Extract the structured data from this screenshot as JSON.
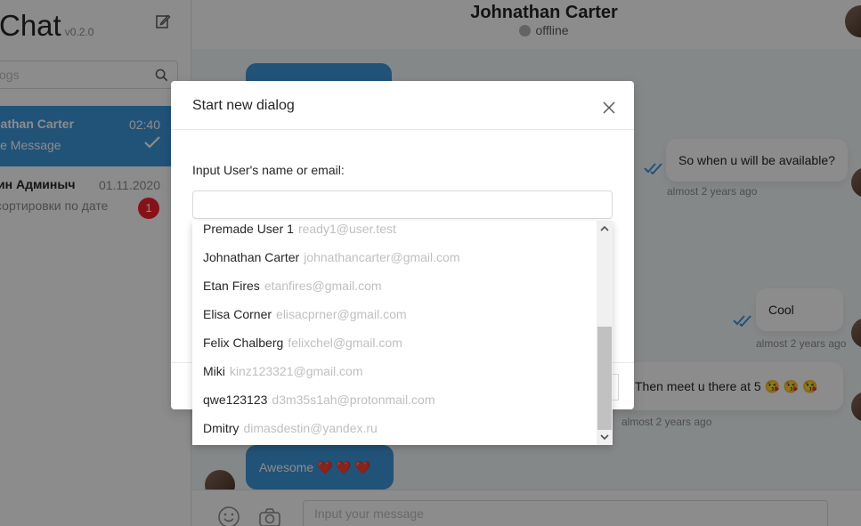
{
  "app": {
    "logo_text": "-Chat",
    "version": "v0.2.0"
  },
  "sidebar": {
    "search_placeholder": "ogs",
    "dialogs": [
      {
        "name": "nathan Carter",
        "time": "02:40",
        "preview": "ice Message",
        "status": "read"
      },
      {
        "name": "ин Админыч",
        "time": "01.11.2020",
        "preview": "сортировки по дате",
        "unread": "1"
      }
    ]
  },
  "chat": {
    "partner_name": "Johnathan Carter",
    "partner_status": "offline",
    "messages": [
      {
        "text": "So when u will be available?",
        "time": "almost 2 years ago",
        "direction": "in"
      },
      {
        "text": "Cool",
        "time": "almost 2 years ago",
        "direction": "in"
      },
      {
        "text": "Then meet u there at 5",
        "emoji": "😘 😘 😘",
        "time": "almost 2 years ago",
        "direction": "in"
      },
      {
        "text": "Awesome",
        "emoji": "❤️ ❤️ ❤️",
        "direction": "out"
      }
    ],
    "input_placeholder": "Input your message"
  },
  "modal": {
    "title": "Start new dialog",
    "field_label": "Input User's name or email:",
    "user_input_value": "",
    "options": [
      {
        "name": "Premade User 1",
        "email": "ready1@user.test"
      },
      {
        "name": "Johnathan Carter",
        "email": "johnathancarter@gmail.com"
      },
      {
        "name": "Etan Fires",
        "email": "etanfires@gmail.com"
      },
      {
        "name": "Elisa Corner",
        "email": "elisacprner@gmail.com"
      },
      {
        "name": "Felix Chalberg",
        "email": "felixchel@gmail.com"
      },
      {
        "name": "Miki",
        "email": "kinz123321@gmail.com"
      },
      {
        "name": "qwe123123",
        "email": "d3m35s1ah@protonmail.com"
      },
      {
        "name": "Dmitry",
        "email": "dimasdestin@yandex.ru"
      }
    ]
  },
  "colors": {
    "accent": "#3c96da",
    "badge": "#f5222d",
    "chat_bg": "#f3f7fa"
  },
  "icons": [
    "edit-icon",
    "search-icon",
    "double-check-icon",
    "close-icon",
    "smile-icon",
    "camera-icon",
    "chevron-up-icon",
    "chevron-down-icon"
  ]
}
